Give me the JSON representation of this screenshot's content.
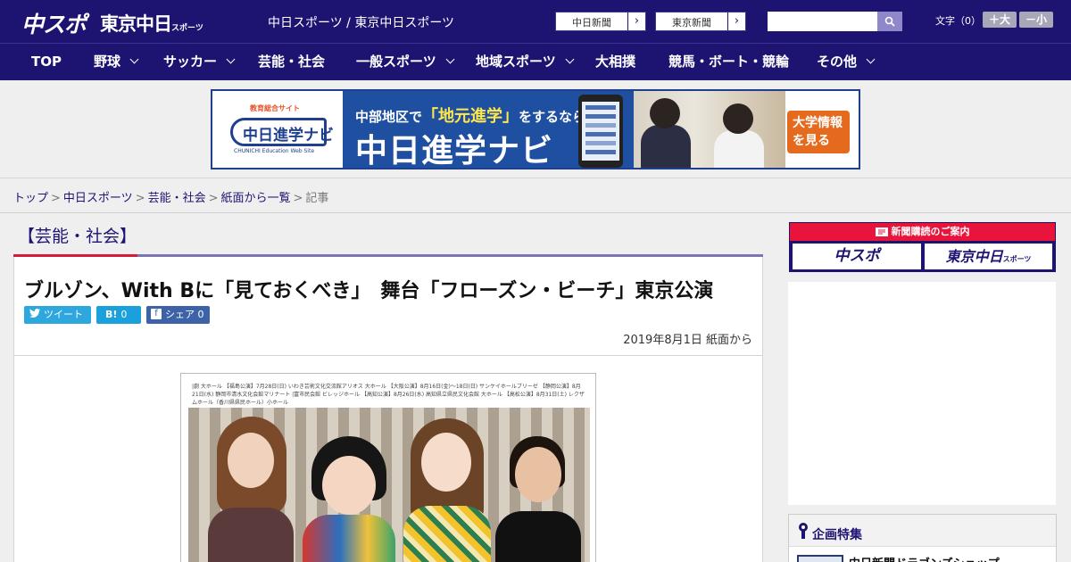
{
  "header": {
    "logo_chuspo": "中スポ",
    "logo_tokyo": "東京中日",
    "logo_tokyo_suffix": "スポーツ",
    "site_title": "中日スポーツ / 東京中日スポーツ",
    "paper_links": [
      {
        "label": "中日新聞"
      },
      {
        "label": "東京新聞"
      }
    ],
    "search": {
      "placeholder": "",
      "value": ""
    },
    "font_size_label": "文字（0）",
    "font_larger": "＋大",
    "font_smaller": "－小"
  },
  "nav": {
    "items": [
      {
        "label": "TOP"
      },
      {
        "label": "野球"
      },
      {
        "label": "サッカー"
      },
      {
        "label": "芸能・社会"
      },
      {
        "label": "一般スポーツ"
      },
      {
        "label": "地域スポーツ"
      },
      {
        "label": "大相撲"
      },
      {
        "label": "競馬・ボート・競輪"
      },
      {
        "label": "その他"
      }
    ]
  },
  "ad_banner": {
    "logo_tag": "教育総合サイト",
    "logo_text": "中日進学ナビ",
    "logo_sub": "CHUNICHI Education Web Site",
    "line1_pre": "中部地区で",
    "line1_em": "「地元進学」",
    "line1_post": "をするなら",
    "line2": "中日進学ナビ",
    "cta_line1": "大学情報",
    "cta_line2": "を見る"
  },
  "breadcrumb": {
    "items": [
      {
        "label": "トップ"
      },
      {
        "label": "中日スポーツ"
      },
      {
        "label": "芸能・社会"
      },
      {
        "label": "紙面から一覧"
      }
    ],
    "current": "記事",
    "separator": ">"
  },
  "section": {
    "title": "【芸能・社会】"
  },
  "article": {
    "title": "ブルゾン、With Bに「見ておくべき」　舞台「フローズン・ビーチ」東京公演",
    "share": {
      "tweet_label": "ツイート",
      "hatena_label": "B!",
      "hatena_count": "0",
      "facebook_label": "シェア",
      "facebook_count": "0"
    },
    "date": "2019年8月1日 紙面から",
    "poster_text": "|劇 大ホール 【福島公演】7月28日(日) いわき芸術文化交流館アリオス 大ホール 【大阪公演】8月16日(金)〜18日(日) サンケイホールブリーゼ 【静岡公演】8月21日(水) 静岡市清水文化会館マリナート |富市民会館 ビレッジホール 【高知公演】8月26日(水) 高知県立県民文化会館 大ホール 【高松公演】8月31日(土) レクザムホール（香川県県民ホール）小ホール"
  },
  "sidebar": {
    "subscribe_header": "新聞購読のご案内",
    "subscribe_chuspo": "中スポ",
    "subscribe_tokyo": "東京中日",
    "subscribe_tokyo_suffix": "スポーツ",
    "feature_title": "企画特集",
    "feature_item": "中日新聞ドラゴンズショップ"
  },
  "colors": {
    "brand_navy": "#1d1472",
    "accent_red": "#d81a3a",
    "twitter": "#2ea6de",
    "hatena": "#1aa0db",
    "facebook": "#3d62a8"
  }
}
